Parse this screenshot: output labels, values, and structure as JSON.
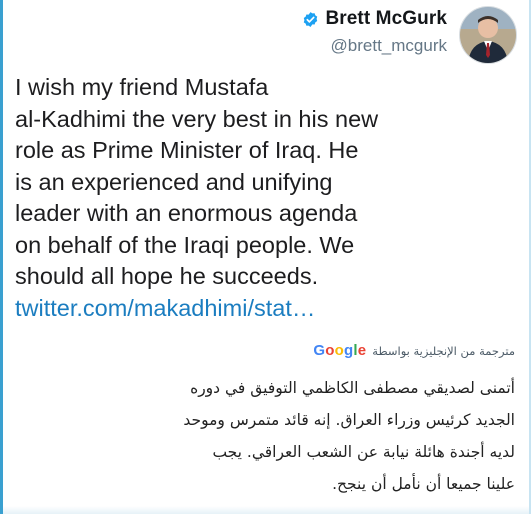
{
  "author": {
    "display_name": "Brett McGurk",
    "handle": "@brett_mcgurk",
    "verified": true,
    "verified_icon": "verified-badge-icon",
    "verified_color": "#1da1f2"
  },
  "tweet": {
    "lines": [
      "I wish my friend Mustafa",
      "al-Kadhimi the very best in his new",
      "role as Prime Minister of Iraq. He",
      "is an experienced and unifying",
      "leader with an enormous agenda",
      "on behalf of the Iraqi people. We",
      "should all hope he succeeds."
    ],
    "link_text": "twitter.com/makadhimi/stat…",
    "link_color": "#1b7dc0"
  },
  "translation": {
    "credit_text": "مترجمة من الإنجليزية بواسطة",
    "provider": "Google",
    "lines": [
      "أتمنى لصديقي مصطفى الكاظمي التوفيق في دوره",
      "الجديد كرئيس وزراء العراق. إنه قائد متمرس وموحد",
      "لديه أجندة هائلة نيابة عن الشعب العراقي. يجب",
      "علينا جميعا أن نأمل أن ينجح."
    ]
  },
  "colors": {
    "frame_accent": "#3aa0d0",
    "handle_gray": "#657786"
  }
}
